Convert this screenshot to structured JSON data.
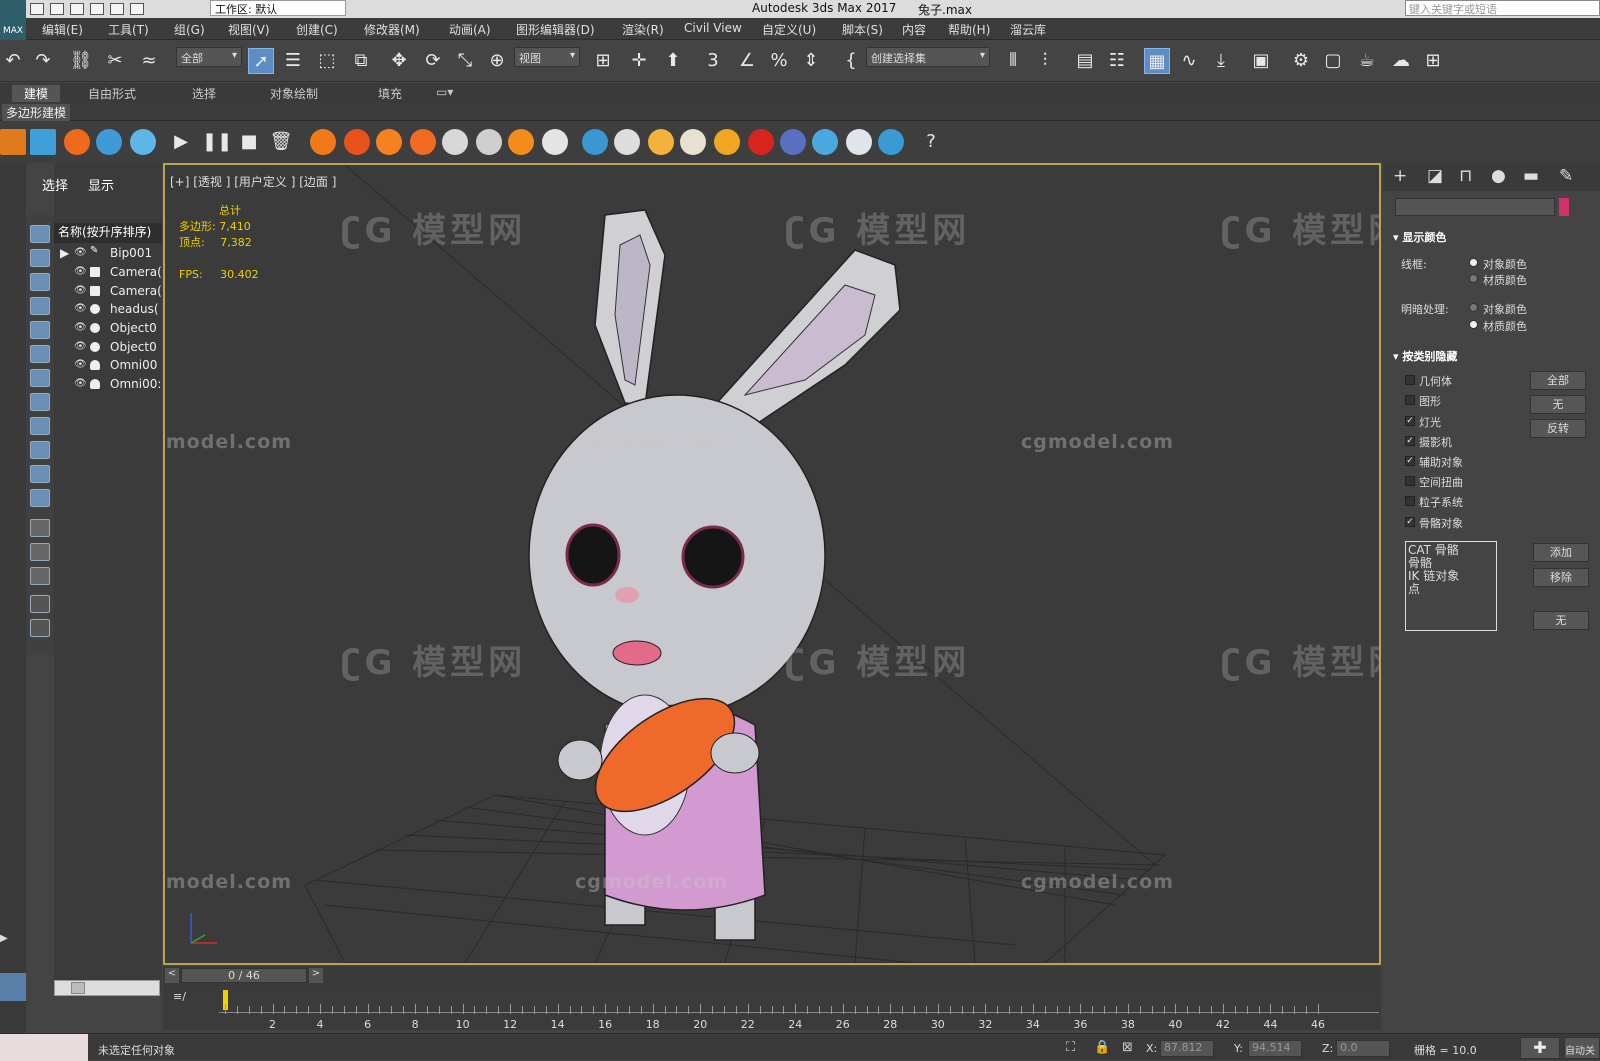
{
  "window": {
    "app_title": "Autodesk 3ds Max 2017",
    "file_name": "兔子.max",
    "workspace": "工作区: 默认",
    "search_placeholder": "键入关键字或短语",
    "logo": "MAX"
  },
  "menu": [
    "编辑(E)",
    "工具(T)",
    "组(G)",
    "视图(V)",
    "创建(C)",
    "修改器(M)",
    "动画(A)",
    "图形编辑器(D)",
    "渲染(R)",
    "Civil View",
    "自定义(U)",
    "脚本(S)",
    "内容",
    "帮助(H)",
    "溜云库"
  ],
  "toolbar": {
    "filter_dropdown": "全部",
    "ref_coord_dropdown": "视图",
    "selection_set_dropdown": "创建选择集"
  },
  "ribbon": {
    "tabs": [
      "建模",
      "自由形式",
      "选择",
      "对象绘制",
      "填充"
    ],
    "active_tab": "建模",
    "panel_label": "多边形建模"
  },
  "scene_explorer": {
    "tab_select": "选择",
    "tab_display": "显示",
    "column_header": "名称(按升序排序)",
    "items": [
      {
        "name": "Bip001",
        "type": "bone"
      },
      {
        "name": "Camera(",
        "type": "camera"
      },
      {
        "name": "Camera(",
        "type": "camera"
      },
      {
        "name": "headus(",
        "type": "geometry"
      },
      {
        "name": "Object0",
        "type": "geometry"
      },
      {
        "name": "Object0",
        "type": "geometry"
      },
      {
        "name": "Omni00",
        "type": "light"
      },
      {
        "name": "Omni00:",
        "type": "light"
      }
    ]
  },
  "viewport": {
    "label": "[+] [透视 ] [用户定义 ] [边面 ]",
    "stats": {
      "total_label": "总计",
      "poly_label": "多边形:",
      "poly_value": "7,410",
      "vert_label": "顶点:",
      "vert_value": "7,382",
      "fps_label": "FPS:",
      "fps_value": "30.402"
    },
    "watermark_logo": "模型网",
    "watermark_url": "cgmodel.com"
  },
  "command_panel": {
    "display_color": {
      "title": "显示颜色",
      "wireframe_label": "线框:",
      "shaded_label": "明暗处理:",
      "opt_object_color": "对象颜色",
      "opt_material_color": "材质颜色",
      "wireframe_selected": "对象颜色",
      "shaded_selected": "材质颜色"
    },
    "hide_by_category": {
      "title": "按类别隐藏",
      "items": [
        {
          "label": "几何体",
          "checked": false
        },
        {
          "label": "图形",
          "checked": false
        },
        {
          "label": "灯光",
          "checked": true
        },
        {
          "label": "摄影机",
          "checked": true
        },
        {
          "label": "辅助对象",
          "checked": true
        },
        {
          "label": "空间扭曲",
          "checked": false
        },
        {
          "label": "粒子系统",
          "checked": false
        },
        {
          "label": "骨骼对象",
          "checked": true
        }
      ],
      "btn_all": "全部",
      "btn_none": "无",
      "btn_invert": "反转",
      "list": [
        "CAT 骨骼",
        "骨骼",
        "IK 链对象",
        "点"
      ],
      "btn_add": "添加",
      "btn_remove": "移除",
      "btn_none2": "无"
    }
  },
  "timeline": {
    "slider": "0 / 46",
    "ticks": [
      "2",
      "4",
      "6",
      "8",
      "10",
      "12",
      "14",
      "16",
      "18",
      "20",
      "22",
      "24",
      "26",
      "28",
      "30",
      "32",
      "34",
      "36",
      "38",
      "40",
      "42",
      "44",
      "46"
    ]
  },
  "status": {
    "message": "未选定任何对象",
    "x_label": "X:",
    "x_value": "87.812",
    "y_label": "Y:",
    "y_value": "94.514",
    "z_label": "Z:",
    "z_value": "0.0",
    "grid": "栅格 = 10.0",
    "auto_key": "自动关"
  },
  "colors": {
    "viewport_border": "#b7a64a",
    "stats_text": "#f0d000",
    "selected_tool": "#5c8dc4"
  }
}
